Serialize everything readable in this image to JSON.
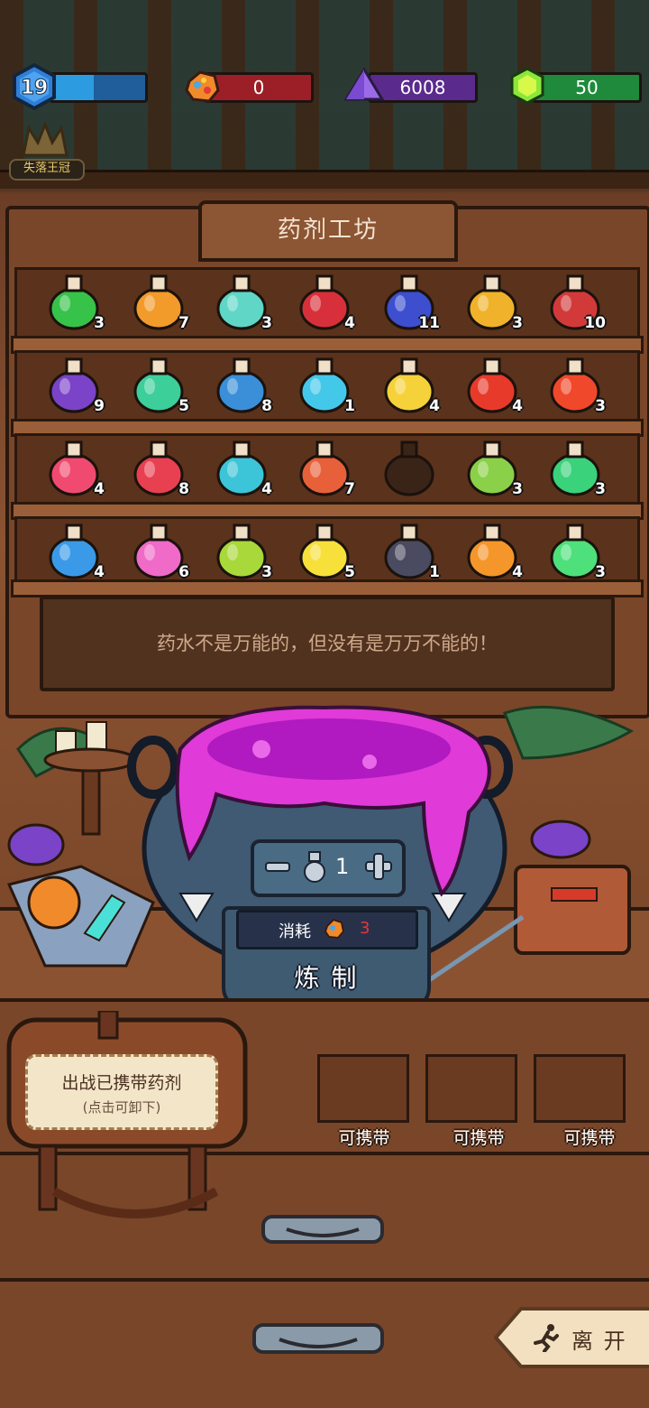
{
  "hud": {
    "level": "19",
    "level_fill": 0.45,
    "ore_value": "0",
    "crystal_value": "6008",
    "gem_value": "50",
    "crown_label": "失落王冠",
    "colors": {
      "level": "#2d9be0",
      "ore": "#9c1f27",
      "crystal": "#5a2a8c",
      "gem": "#1f8a3c"
    }
  },
  "workshop": {
    "title": "药剂工坊",
    "message": "药水不是万能的，但没有是万万不能的！",
    "shelves": [
      [
        {
          "icon": "green-gem-potion-icon",
          "count": "3",
          "color": "#37c24a"
        },
        {
          "icon": "orange-square-potion-icon",
          "count": "7",
          "color": "#f29a2a"
        },
        {
          "icon": "rainbow-jar-potion-icon",
          "count": "3",
          "color": "#5fd6c6"
        },
        {
          "icon": "red-round-potion-icon",
          "count": "4",
          "color": "#d8303a"
        },
        {
          "icon": "blue-fin-potion-icon",
          "count": "11",
          "color": "#3d4fcf"
        },
        {
          "icon": "yellow-flask-potion-icon",
          "count": "3",
          "color": "#f0b22a"
        },
        {
          "icon": "red-capped-potion-icon",
          "count": "10",
          "color": "#d23a3a"
        }
      ],
      [
        {
          "icon": "purple-eye-potion-icon",
          "count": "9",
          "color": "#7a43c8"
        },
        {
          "icon": "teal-flask-potion-icon",
          "count": "5",
          "color": "#3ccf9a"
        },
        {
          "icon": "blue-curvy-potion-icon",
          "count": "8",
          "color": "#3a8fd8"
        },
        {
          "icon": "cyan-box-potion-icon",
          "count": "1",
          "color": "#44c8ea"
        },
        {
          "icon": "yellow-cone-potion-icon",
          "count": "4",
          "color": "#f5d23a"
        },
        {
          "icon": "flame-jar-potion-icon",
          "count": "4",
          "color": "#e83a2a"
        },
        {
          "icon": "flame-cone-potion-icon",
          "count": "3",
          "color": "#f0482a"
        }
      ],
      [
        {
          "icon": "pink-tilted-potion-icon",
          "count": "4",
          "color": "#f04a70"
        },
        {
          "icon": "red-diamond-potion-icon",
          "count": "8",
          "color": "#e84050"
        },
        {
          "icon": "cyan-round-potion-icon",
          "count": "4",
          "color": "#3cc4d8"
        },
        {
          "icon": "coral-flask-potion-icon",
          "count": "7",
          "color": "#e8603a"
        },
        {
          "icon": "empty-slot-icon",
          "count": "",
          "color": "#3a2418"
        },
        {
          "icon": "rainbow-urn-potion-icon",
          "count": "3",
          "color": "#8ad048"
        },
        {
          "icon": "sprout-potion-icon",
          "count": "3",
          "color": "#3ad27a"
        }
      ],
      [
        {
          "icon": "blue-crown-potion-icon",
          "count": "4",
          "color": "#3a9ae8"
        },
        {
          "icon": "pink-purple-potion-icon",
          "count": "6",
          "color": "#f06ac8"
        },
        {
          "icon": "leaf-urn-potion-icon",
          "count": "3",
          "color": "#a8d83a"
        },
        {
          "icon": "yellow-bottle-potion-icon",
          "count": "5",
          "color": "#f8e03a"
        },
        {
          "icon": "dark-bow-potion-icon",
          "count": "1",
          "color": "#4a4a60"
        },
        {
          "icon": "orange-ornate-potion-icon",
          "count": "4",
          "color": "#f5962a"
        },
        {
          "icon": "green-heart-potion-icon",
          "count": "3",
          "color": "#4ee07a"
        }
      ]
    ]
  },
  "brew": {
    "quantity": "1",
    "cost_label": "消耗",
    "cost_value": "3",
    "brew_label": "炼 制",
    "slime_color": "#e03ad8"
  },
  "carry": {
    "bag_label": "出战已携带药剂",
    "bag_hint": "(点击可卸下)",
    "slots": [
      "可携带",
      "可携带",
      "可携带"
    ]
  },
  "leave_label": "离 开"
}
